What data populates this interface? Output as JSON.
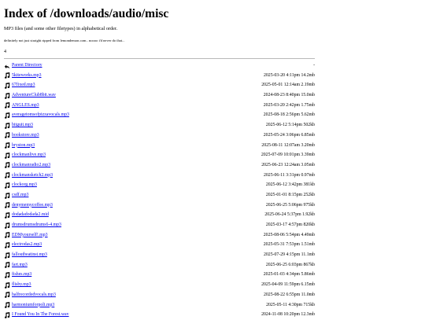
{
  "page": {
    "title": "Index of /downloads/audio/misc",
    "subtitle": "MP3 files (and some other filetypes) in alphabetical order.",
    "disclaimer": "definitely not just straight ripped from lemondemon.com.. noooo i'd never do that...",
    "counter": "4"
  },
  "parent": {
    "name": "Parent Directory",
    "meta": "-"
  },
  "files": [
    {
      "name": "5kiteworks.mp3",
      "meta": "2025-03-20 4:11pm 14.2mb"
    },
    {
      "name": "67fixed.mp3",
      "meta": "2025-05-01 12:14am 2.19mb"
    },
    {
      "name": "AdventureClub8bit.wav",
      "meta": "2024-08-23 8:40pm 15.0mb"
    },
    {
      "name": "ANGLES.mp3",
      "meta": "2025-03-20 2:42pm 1.75mb"
    },
    {
      "name": "averagetomsofpizzavocals.mp3",
      "meta": "2025-08-18 2:56pm 5.62mb"
    },
    {
      "name": "bitguit.mp3",
      "meta": "2025-06-12 5:14pm 502kb"
    },
    {
      "name": "bookstore.mp3",
      "meta": "2025-05-24 3:06pm 6.85mb"
    },
    {
      "name": "bryston.mp3",
      "meta": "2025-08-11 12:07am 3.20mb"
    },
    {
      "name": "clockmanlive.mp3",
      "meta": "2025-07-09 10:01pm 3.39mb"
    },
    {
      "name": "clockmanradio2.mp3",
      "meta": "2025-06-23 12:24am 3.05mb"
    },
    {
      "name": "clockmansketch2.mp3",
      "meta": "2025-06-11 3:31pm 0.97mb"
    },
    {
      "name": "clockorg.mp3",
      "meta": "2025-06-12 3:42pm 381kb"
    },
    {
      "name": "csdf.mp3",
      "meta": "2025-01-01 8:15pm 252kb"
    },
    {
      "name": "denymemycoffee.mp3",
      "meta": "2025-06-25 5:06pm 975kb"
    },
    {
      "name": "dodadadodada2.mid",
      "meta": "2025-06-24 5:37pm 1.92kb"
    },
    {
      "name": "drumsdrumsdrums6-4.mp3",
      "meta": "2025-03-17 4:57pm 820kb"
    },
    {
      "name": "EDMyourself!.mp3",
      "meta": "2025-08-06 5:54pm 4.49mb"
    },
    {
      "name": "electrodas2.mp3",
      "meta": "2025-05-31 7:53pm 1.51mb"
    },
    {
      "name": "falloutbeatinst.mp3",
      "meta": "2025-07-29 4:15pm 11.1mb"
    },
    {
      "name": "fart.mp3",
      "meta": "2025-06-25 6:03pm 867kb"
    },
    {
      "name": "fishes.mp3",
      "meta": "2025-01-03 4:34pm 5.86mb"
    },
    {
      "name": "flisby.mp3",
      "meta": "2025-04-09 11:59pm 6.15mb"
    },
    {
      "name": "halfrecordedvocals.mp3",
      "meta": "2025-08-22 6:55pm 11.0mb"
    },
    {
      "name": "harmoniumforpoli.mp3",
      "meta": "2025-05-11 4:30pm 715kb"
    },
    {
      "name": "I Found You In The Forest.wav",
      "meta": "2024-11-08 10:20pm 12.3mb"
    }
  ]
}
